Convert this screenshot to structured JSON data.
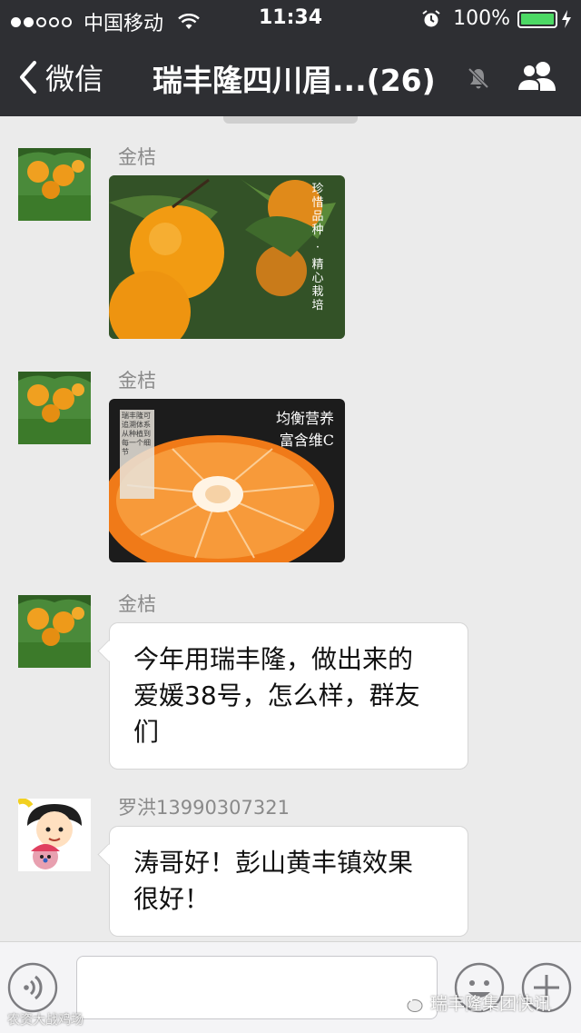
{
  "status_bar": {
    "carrier": "中国移动",
    "time": "11:34",
    "battery": "100%",
    "battery_level": 1.0,
    "signal_bars_filled": 2,
    "signal_bars_total": 5
  },
  "nav": {
    "back_label": "微信",
    "title": "瑞丰隆四川眉...(26)",
    "icons": {
      "back": "chevron-left-icon",
      "mute": "bell-muted-icon",
      "group": "group-members-icon"
    }
  },
  "messages": [
    {
      "sender": "金桔",
      "type": "image",
      "image": "orange-on-branch",
      "image_caption_1": "珍惜品种",
      "image_caption_2": "精心栽培"
    },
    {
      "sender": "金桔",
      "type": "image",
      "image": "orange-cross-section",
      "image_caption_1": "均衡营养",
      "image_caption_2": "富含维C",
      "image_side_text": "瑞丰隆可追溯体系从种植到每一个细节"
    },
    {
      "sender": "金桔",
      "type": "text",
      "text_lines": [
        "今年用瑞丰隆，做出来的",
        "爱媛38号，怎么样，群友",
        "们"
      ]
    },
    {
      "sender": "罗洪13990307321",
      "type": "text",
      "text_lines": [
        "涛哥好！彭山黄丰镇效果",
        "很好！"
      ]
    }
  ],
  "input_bar": {
    "icons": {
      "voice": "voice-icon",
      "emoji": "emoji-icon",
      "plus": "plus-icon"
    }
  },
  "watermarks": {
    "left": "农资大战鸡场",
    "right": "瑞丰隆集团快讯"
  },
  "colors": {
    "header_bg": "#2e2f33",
    "chat_bg": "#ebebeb",
    "bubble_bg": "#ffffff",
    "battery_green": "#4cd964"
  }
}
